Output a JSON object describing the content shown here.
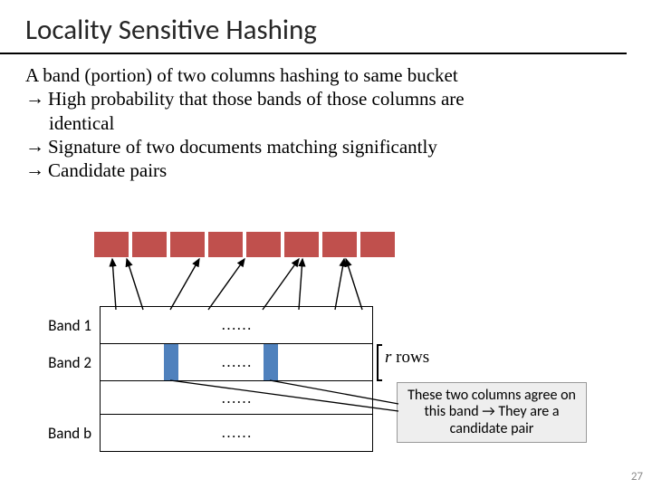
{
  "title": "Locality Sensitive Hashing",
  "lines": {
    "l0": "A band (portion) of two columns hashing to same bucket",
    "l1": "High probability that those bands of those columns are",
    "l1b": "identical",
    "l2": "Signature of two documents matching significantly",
    "l3": "Candidate pairs"
  },
  "arrow_glyph": "→",
  "bands": {
    "b1": "Band 1",
    "b2": "Band 2",
    "bb": "Band b",
    "dots": "……"
  },
  "rrows_i": "r",
  "rrows_rest": " rows",
  "callout": "These two columns agree on this band → They are a candidate pair",
  "slidenum": "27"
}
